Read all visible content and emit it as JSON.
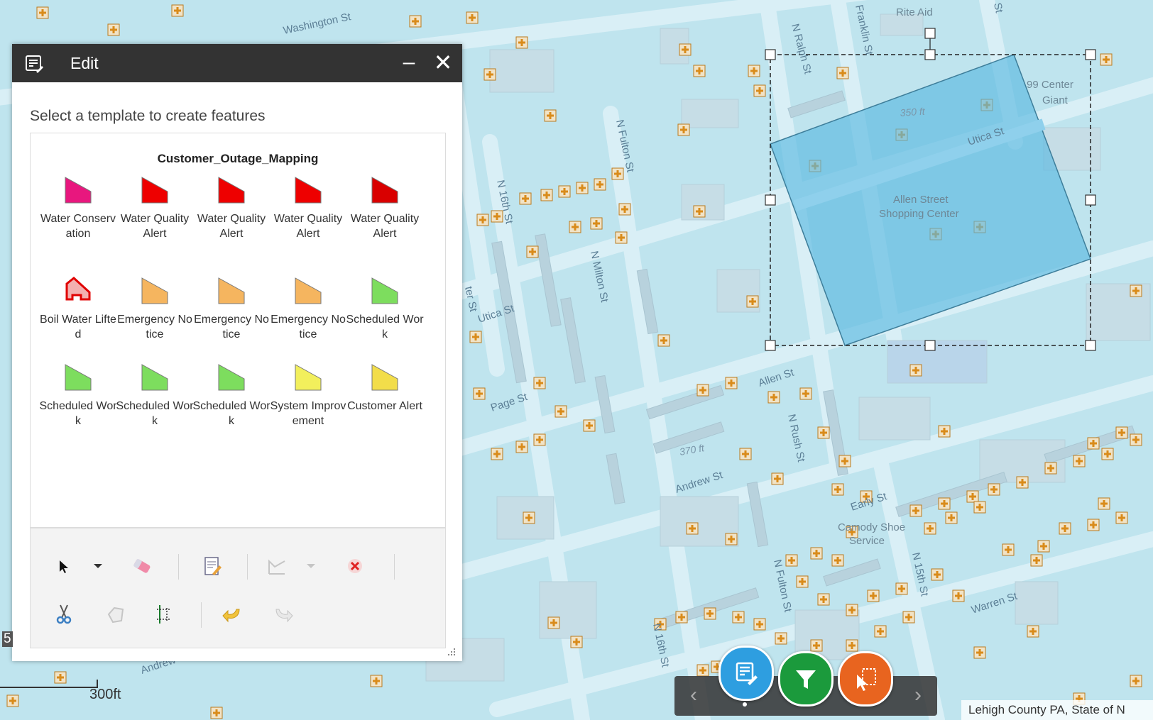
{
  "map": {
    "streets": {
      "washington": "Washington St",
      "ralph": "N Ralph St",
      "franklin": "Franklin St",
      "fulton_n": "N Fulton St",
      "sixteenth_n": "N 16th St",
      "milton": "N Milton St",
      "utica_e": "Utica St",
      "utica_w": "Utica St",
      "page": "Page St",
      "allen": "Allen St",
      "rush": "N Rush St",
      "andrew": "Andrew St",
      "andrew_sw": "Andrew St",
      "early": "Early St",
      "fulton_s": "N Fulton St",
      "fifteenth": "N 15th St",
      "warren": "Warren St",
      "sixteenth_s": "N 16th St",
      "st_partial": "St",
      "ter_st": "ter St"
    },
    "pois": {
      "rite_aid": "Rite Aid",
      "center_giant_1": "99 Center",
      "center_giant_2": "Giant",
      "shopping_1": "Allen Street",
      "shopping_2": "Shopping Center",
      "camody_1": "Camody Shoe",
      "camody_2": "Service"
    },
    "dimensions": {
      "d350": "350 ft",
      "d370": "370 ft"
    },
    "colors": {
      "background": "#bfe4ee",
      "road": "#d6eef5",
      "block": "#c3dae4",
      "selected_fill": "#5ab8e0",
      "marker": "#d98b1a"
    }
  },
  "edit_panel": {
    "title": "Edit",
    "minimize_label": "–",
    "close_label": "✕",
    "instruction": "Select a template to create features",
    "layer_name": "Customer_Outage_Mapping",
    "templates": [
      {
        "label": "Water Conservation",
        "fill": "#e8177e"
      },
      {
        "label": "Water Quality Alert",
        "fill": "#ee0000"
      },
      {
        "label": "Water Quality Alert",
        "fill": "#ee0000"
      },
      {
        "label": "Water Quality Alert",
        "fill": "#ee0000"
      },
      {
        "label": "Water Quality Alert",
        "fill": "#d90000"
      },
      {
        "label": "Boil Water Lifted",
        "fill": "#e00000"
      },
      {
        "label": "Emergency Notice",
        "fill": "#f5b55f"
      },
      {
        "label": "Emergency Notice",
        "fill": "#f5b55f"
      },
      {
        "label": "Emergency Notice",
        "fill": "#f5b55f"
      },
      {
        "label": "Scheduled Work",
        "fill": "#7ddd5e"
      },
      {
        "label": "Scheduled Work",
        "fill": "#7ddd5e"
      },
      {
        "label": "Scheduled Work",
        "fill": "#7ddd5e"
      },
      {
        "label": "Scheduled Work",
        "fill": "#7ddd5e"
      },
      {
        "label": "System Improvement",
        "fill": "#f2ef5c"
      },
      {
        "label": "Customer Alert",
        "fill": "#f2dd4a"
      }
    ],
    "tools": [
      "select-arrow-icon",
      "dropdown-icon",
      "eraser-icon",
      "attributes-icon",
      "reshape-icon",
      "dropdown-icon",
      "delete-icon",
      "cut-icon",
      "union-icon",
      "split-icon",
      "undo-icon",
      "redo-icon"
    ]
  },
  "scale_bar": {
    "label": "300ft"
  },
  "bottom_toolbar": {
    "prev": "‹",
    "next": "›",
    "buttons": [
      {
        "name": "edit",
        "color": "#2e9ee0"
      },
      {
        "name": "filter",
        "color": "#1b9a3c"
      },
      {
        "name": "select",
        "color": "#e8641f"
      }
    ]
  },
  "attribution": "Lehigh County PA, State of N",
  "left_edge_label": "5"
}
